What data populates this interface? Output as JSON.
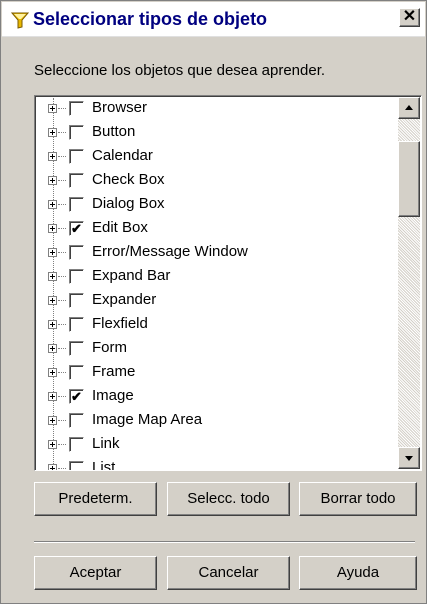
{
  "window": {
    "title": "Seleccionar tipos de objeto",
    "close_label": "✕",
    "title_color": "#000080"
  },
  "instruction": "Seleccione los objetos que desea aprender.",
  "object_types": [
    {
      "label": "Browser",
      "checked": false
    },
    {
      "label": "Button",
      "checked": false
    },
    {
      "label": "Calendar",
      "checked": false
    },
    {
      "label": "Check Box",
      "checked": false
    },
    {
      "label": "Dialog Box",
      "checked": false
    },
    {
      "label": "Edit Box",
      "checked": true
    },
    {
      "label": "Error/Message Window",
      "checked": false
    },
    {
      "label": "Expand Bar",
      "checked": false
    },
    {
      "label": "Expander",
      "checked": false
    },
    {
      "label": "Flexfield",
      "checked": false
    },
    {
      "label": "Form",
      "checked": false
    },
    {
      "label": "Frame",
      "checked": false
    },
    {
      "label": "Image",
      "checked": true
    },
    {
      "label": "Image Map Area",
      "checked": false
    },
    {
      "label": "Link",
      "checked": false
    },
    {
      "label": "List",
      "checked": false
    }
  ],
  "buttons": {
    "default": "Predeterm.",
    "select_all": "Selecc. todo",
    "clear_all": "Borrar todo",
    "ok": "Aceptar",
    "cancel": "Cancelar",
    "help": "Ayuda"
  },
  "icons": {
    "title": "filter-funnel-icon",
    "expander": "plus-box-icon",
    "scroll_up": "arrow-up-icon",
    "scroll_down": "arrow-down-icon"
  }
}
